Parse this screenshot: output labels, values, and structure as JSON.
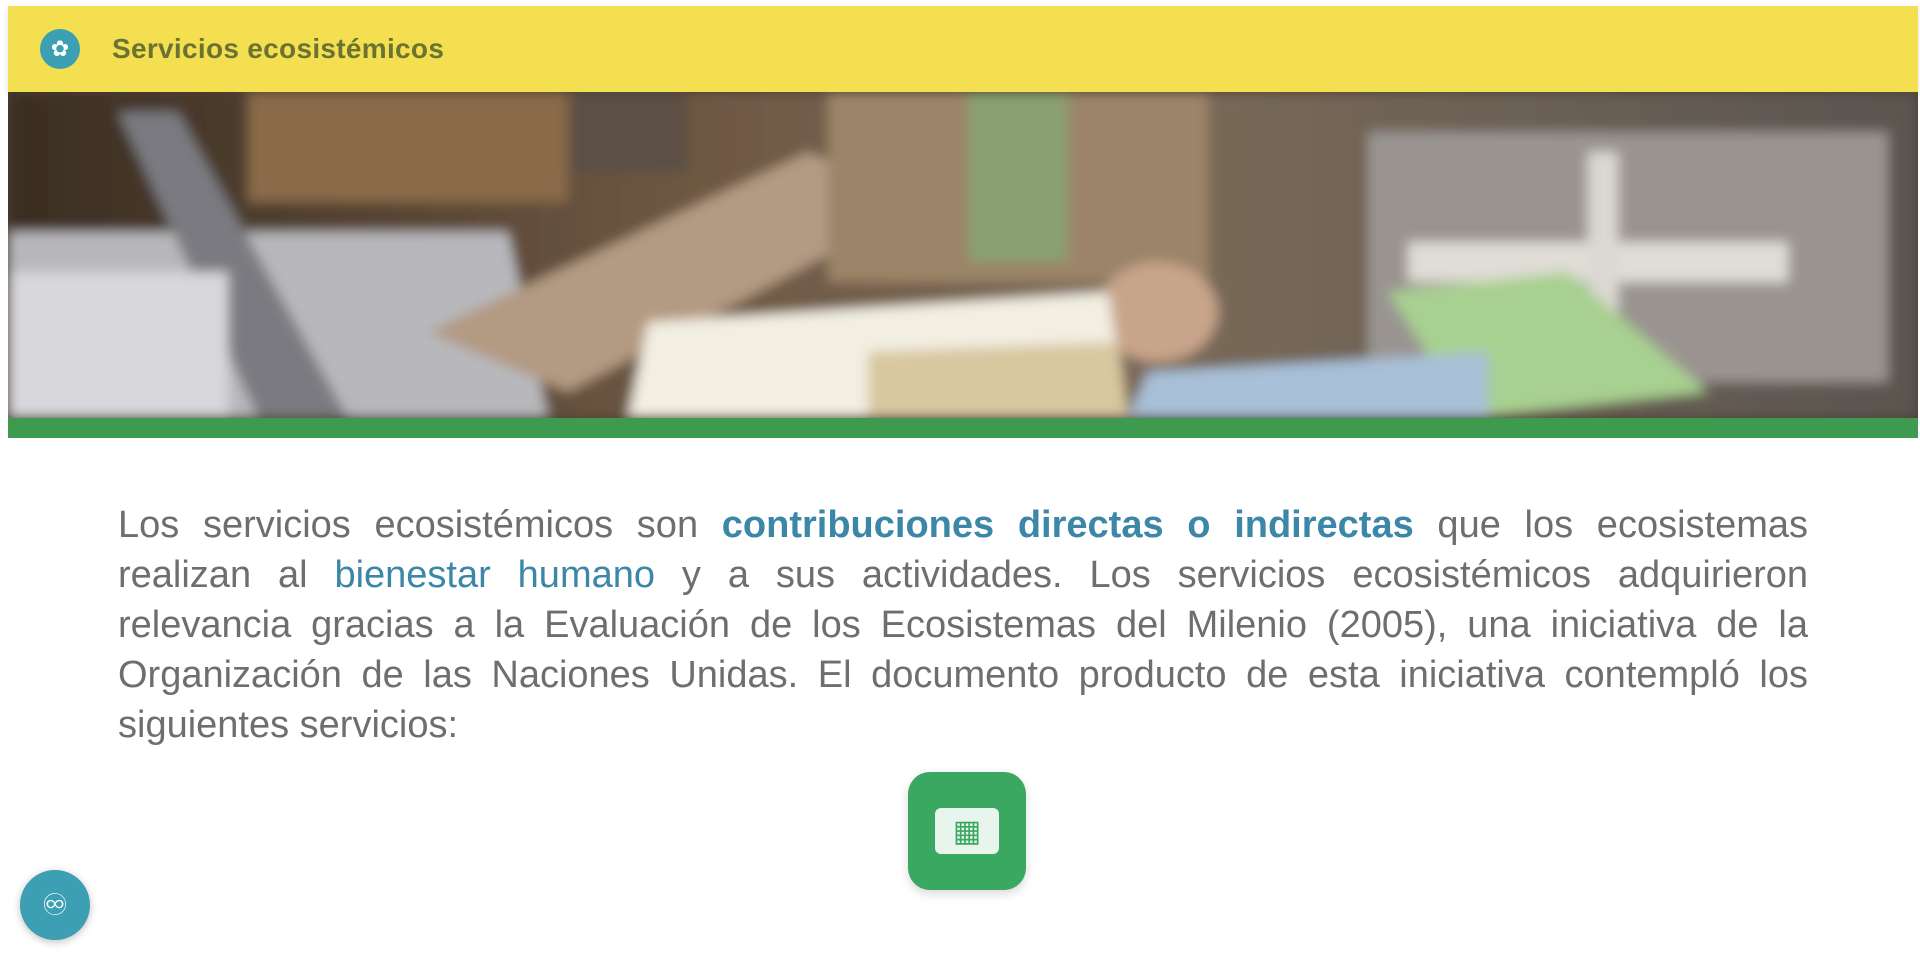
{
  "header": {
    "title": "Servicios ecosistémicos",
    "icon": "leaf-icon",
    "background_color": "#f3df4f"
  },
  "hero": {
    "image_description_icon": "photo-laptop-notebook",
    "accent_color": "#3d9a4f"
  },
  "content": {
    "paragraph_part1": "Los servicios ecosistémicos son ",
    "link1": "contribuciones directas o indirectas",
    "paragraph_part2": " que los ecosistemas realizan al ",
    "link2": "bienestar humano",
    "paragraph_part3": " y a sus actividades. Los servicios ecosistémicos adquirieron relevancia gracias a la Evaluación de los Ecosistemas del Milenio (2005), una iniciativa de la Organización de las Naciones Unidas. El documento producto de esta iniciativa contempló los siguientes servicios:"
  },
  "buttons": {
    "center_icon": "grid-icon",
    "floating_icon": "accessibility-icon"
  },
  "colors": {
    "link": "#3c86a8",
    "button_green": "#3aa860",
    "floating_blue": "#3c9fb3"
  }
}
